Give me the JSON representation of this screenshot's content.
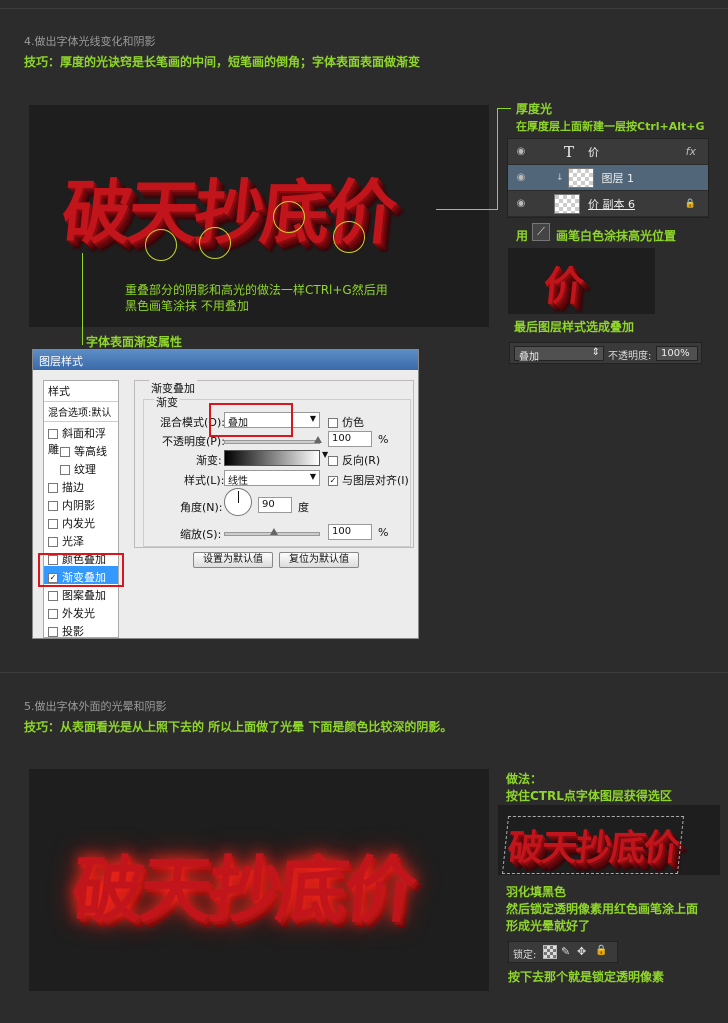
{
  "s4": {
    "title": "4.做出字体光线变化和阴影",
    "tip": "技巧：厚度的光诀窍是长笔画的中间，短笔画的倒角；字体表面表面做渐变",
    "art_text": "破天抄底价",
    "overlap_note_1": "重叠部分的阴影和高光的做法一样CTRl+G然后用",
    "overlap_note_2": "黑色画笔涂抹 不用叠加",
    "thickness_title": "厚度光",
    "thickness_desc": "在厚度层上面新建一层按Ctrl+Alt+G",
    "layers": {
      "row1_name": "价",
      "row2_name": "图层 1",
      "row3_name": "价 副本 6",
      "fx": "fx"
    },
    "brush_note_pre": "用",
    "brush_note_post": "画笔白色涂抹高光位置",
    "small_char": "价",
    "last_layer_note": "最后图层样式选成叠加",
    "blend_bar": {
      "mode": "叠加",
      "opacity_label": "不透明度:",
      "opacity_value": "100%"
    },
    "gradient_prop_label": "字体表面渐变属性"
  },
  "dialog": {
    "title": "图层样式",
    "styles_header": "样式",
    "blend_default": "混合选项:默认",
    "items": [
      "斜面和浮雕",
      "等高线",
      "纹理",
      "描边",
      "内阴影",
      "内发光",
      "光泽",
      "颜色叠加",
      "渐变叠加",
      "图案叠加",
      "外发光",
      "投影"
    ],
    "group_title": "渐变叠加",
    "sub_title": "渐变",
    "blend_mode_label": "混合模式(O):",
    "blend_mode_value": "叠加",
    "dither": "仿色",
    "opacity_label": "不透明度(P):",
    "opacity_value": "100",
    "pct": "%",
    "gradient_label": "渐变:",
    "reverse": "反向(R)",
    "style_label": "样式(L):",
    "style_value": "线性",
    "align": "与图层对齐(I)",
    "angle_label": "角度(N):",
    "angle_value": "90",
    "degree": "度",
    "scale_label": "缩放(S):",
    "scale_value": "100",
    "btn_default": "设置为默认值",
    "btn_reset": "复位为默认值"
  },
  "s5": {
    "title": "5.做出字体外面的光晕和阴影",
    "tip": "技巧：从表面看光是从上照下去的 所以上面做了光晕 下面是颜色比较深的阴影。",
    "art_text": "破天抄底价",
    "method_title": "做法：",
    "method_1": "按住CTRL点字体图层获得选区",
    "feather_1": "羽化填黑色",
    "feather_2": "然后锁定透明像素用红色画笔涂上面",
    "feather_3": "形成光晕就好了",
    "lock_label": "锁定:",
    "lock_note": "按下去那个就是锁定透明像素"
  },
  "colors": {
    "accent_green": "#8fd62a",
    "text_red": "#c1151b",
    "highlight_box": "#d8161b",
    "selection_blue": "#3399ff"
  }
}
